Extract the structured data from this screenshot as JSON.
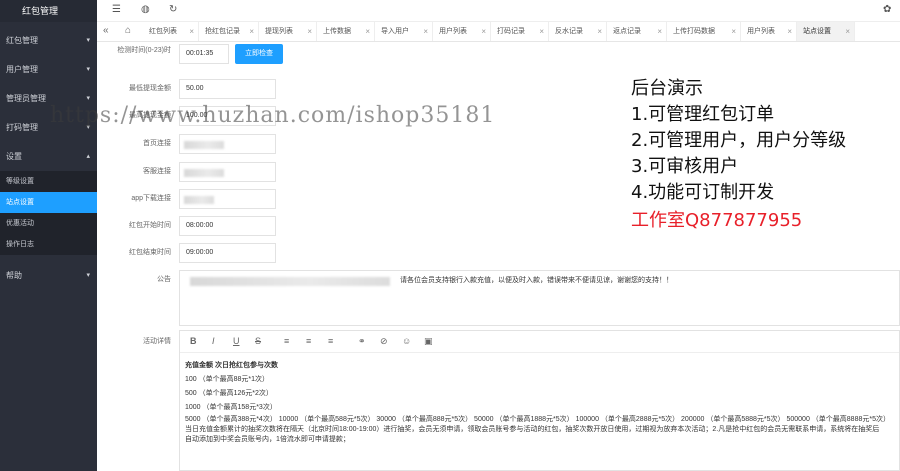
{
  "sidebar": {
    "brand": "红包管理",
    "menus": [
      {
        "label": "红包管理",
        "arrow": "▾"
      },
      {
        "label": "用户管理",
        "arrow": "▾"
      },
      {
        "label": "管理员管理",
        "arrow": "▾"
      },
      {
        "label": "打码管理",
        "arrow": "▾"
      },
      {
        "label": "设置",
        "arrow": "▴"
      }
    ],
    "settings_items": [
      "等级设置",
      "站点设置",
      "优惠活动",
      "操作日志"
    ],
    "help": {
      "label": "帮助",
      "arrow": "▾"
    }
  },
  "topbar": {
    "icons": [
      "menu-toggle-icon",
      "globe-icon",
      "refresh-icon",
      "theme-icon"
    ]
  },
  "tabs": [
    "红包列表",
    "抢红包记录",
    "提现列表",
    "上传数据",
    "导入用户",
    "用户列表",
    "打码记录",
    "反水记录",
    "返点记录",
    "上传打码数据",
    "用户列表",
    "站点设置"
  ],
  "form": {
    "check_time_label": "检测时间(0-23)时",
    "check_time_value": "00:01:35",
    "check_button": "立即检查",
    "min_withdraw_label": "最低提现金额",
    "min_withdraw_value": "50.00",
    "max_withdraw_label": "最高提现金额",
    "max_withdraw_value": "100.00",
    "home_link_label": "首页连接",
    "service_link_label": "客服连接",
    "app_link_label": "app下载连接",
    "start_time_label": "红包开始时间",
    "start_time_value": "08:00:00",
    "end_time_label": "红包结束时间",
    "end_time_value": "09:00:00",
    "notice_label": "公告",
    "notice_text": "请各位会员支持银行入款充值，以便及时入款，错误带来不便请见谅，谢谢您的支持！！",
    "activity_label": "活动详情"
  },
  "editor": {
    "lines": [
      "充值金额 次日抢红包参与次数",
      "100 （单个最高88元*1次）",
      "500 （单个最高126元*2次）",
      "1000 （单个最高158元*3次）",
      "5000 （单个最高388元*4次） 10000 （单个最高588元*5次） 30000 （单个最高888元*5次） 50000 （单个最高1888元*5次） 100000 （单个最高2888元*5次） 200000 （单个最高5888元*5次） 500000 （单个最高8888元*5次）",
      "当日充值金额累计的抽奖次数将在隔天（北京时间18:00-19:00）进行抽奖，会员无须申请，领取会员账号参与活动的红包，抽奖次数开放日使用，过期视为放弃本次活动；2.凡是抢中红包的会员无需联系申请，系统将在抽奖后",
      "自动添加到中奖会员账号内，1倍流水即可申请提款；"
    ]
  },
  "overlay": {
    "title": "后台演示",
    "items": [
      "1.可管理红包订单",
      "2.可管理用户，用户分等级",
      "3.可审核用户",
      "4.功能可订制开发"
    ],
    "contact": "工作室Q877877955",
    "watermark": "https://www.huzhan.com/ishop35181",
    "colors": {
      "contact": "#e8202a",
      "accent": "#1e9fff",
      "sidebar": "#2b2f3a"
    }
  }
}
